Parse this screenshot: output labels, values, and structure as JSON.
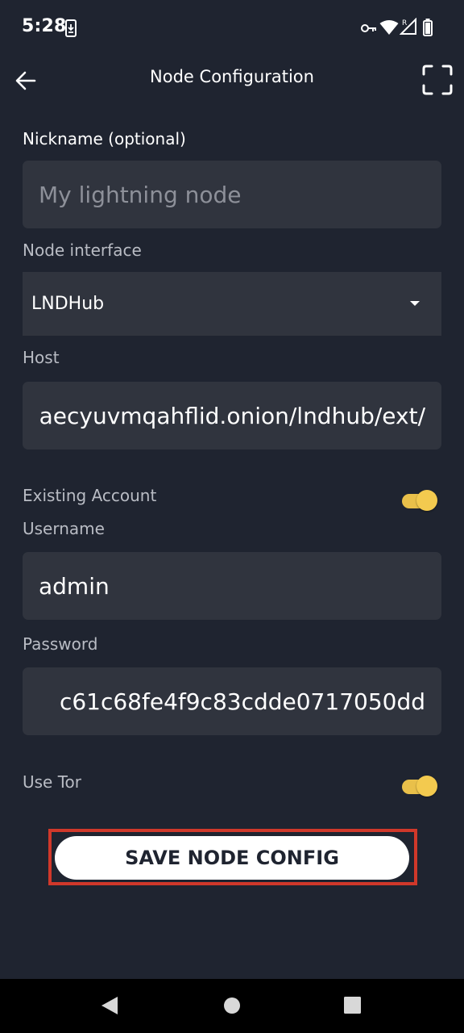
{
  "status_bar": {
    "time": "5:28",
    "icons": [
      "download-notification-icon",
      "vpn-key-icon",
      "wifi-icon",
      "signal-icon",
      "battery-icon"
    ]
  },
  "toolbar": {
    "title": "Node Configuration",
    "back_icon": "arrow-left-icon",
    "scan_icon": "scan-frame-icon"
  },
  "form": {
    "nickname": {
      "label": "Nickname (optional)",
      "placeholder": "My lightning node"
    },
    "node_interface": {
      "label": "Node interface",
      "selected": "LNDHub"
    },
    "host": {
      "label": "Host",
      "value": "aecyuvmqahflid.onion/lndhub/ext/"
    },
    "existing_account": {
      "label": "Existing Account",
      "enabled": true
    },
    "username": {
      "label": "Username",
      "value": "admin"
    },
    "password": {
      "label": "Password",
      "value": "c61c68fe4f9c83cdde0717050dd"
    },
    "use_tor": {
      "label": "Use Tor",
      "enabled": true
    },
    "save_label": "SAVE NODE CONFIG"
  },
  "colors": {
    "background": "#1f2430",
    "input_background": "#30343e",
    "toggle_accent": "#f3ca4f",
    "highlight_border": "#d0382a"
  },
  "nav_bar": {
    "icons": [
      "back-triangle-icon",
      "home-circle-icon",
      "recents-square-icon"
    ]
  }
}
